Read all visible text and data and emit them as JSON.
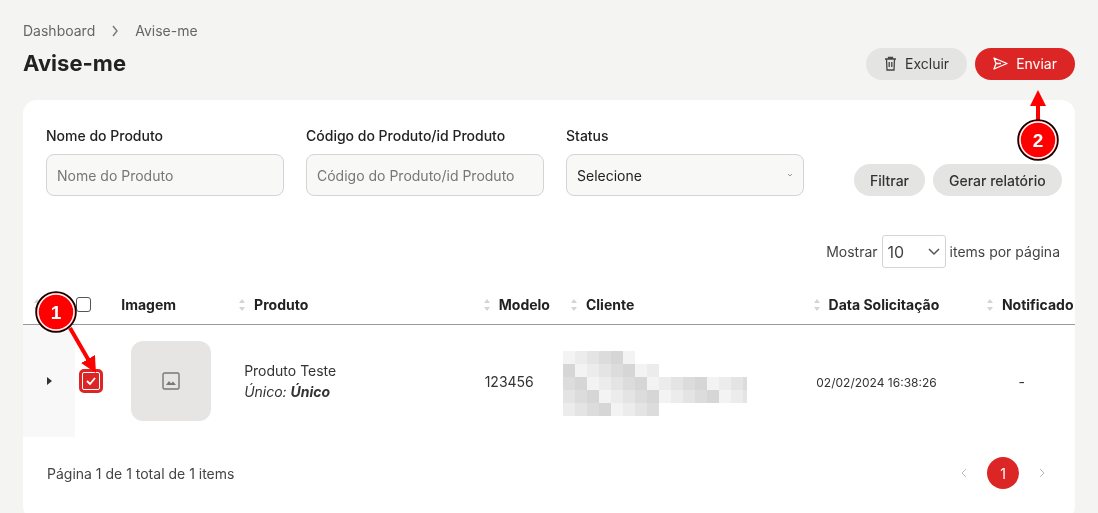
{
  "breadcrumb": [
    {
      "label": "Dashboard"
    },
    {
      "label": "Avise-me"
    }
  ],
  "title": "Avise-me",
  "actions": [
    {
      "kind": "delete",
      "label": "Excluir"
    },
    {
      "kind": "send",
      "label": "Enviar"
    }
  ],
  "filters": [
    {
      "kind": "text",
      "label": "Nome do Produto",
      "placeholder": "Nome do Produto"
    },
    {
      "kind": "text",
      "label": "Código do Produto/id Produto",
      "placeholder": "Código do Produto/id Produto"
    },
    {
      "kind": "select",
      "label": "Status",
      "value": "Selecione"
    }
  ],
  "filter_buttons": [
    "Filtrar",
    "Gerar relatório"
  ],
  "page_size": {
    "before": "Mostrar",
    "value": "10",
    "after": "items por página"
  },
  "table": {
    "header_checked": false,
    "columns": [
      {
        "label": "Imagem",
        "sortable": false
      },
      {
        "label": "Produto",
        "sortable": true
      },
      {
        "label": "Modelo",
        "sortable": true
      },
      {
        "label": "Cliente",
        "sortable": true
      },
      {
        "label": "Data Solicitação",
        "sortable": true
      },
      {
        "label": "Notificado",
        "sortable": true
      }
    ],
    "rows": [
      {
        "checked": true,
        "expanded": false,
        "product": "Produto Teste",
        "variant": "Único: **Único**",
        "model": "123456",
        "date": "02/02/2024 16:38:26",
        "notified": "-"
      }
    ]
  },
  "footer": "Página 1 de 1 total de 1 items",
  "pagination": [
    {
      "label": "1",
      "selected": true
    }
  ],
  "annotations": [
    {
      "label": "1"
    },
    {
      "label": "2"
    }
  ]
}
